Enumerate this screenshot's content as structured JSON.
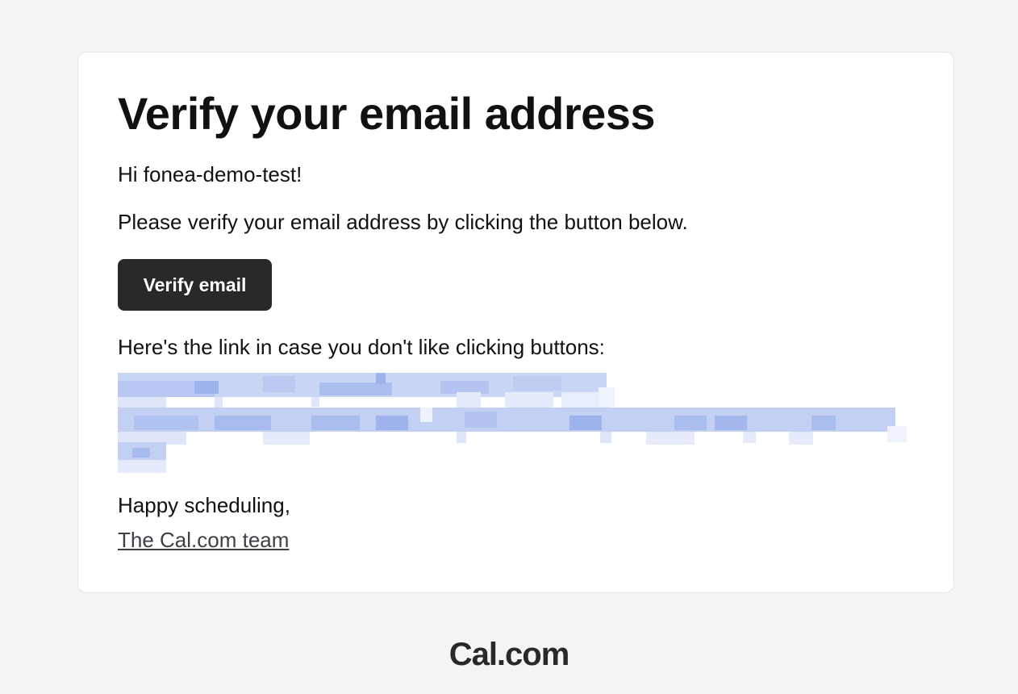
{
  "email": {
    "title": "Verify your email address",
    "greeting": "Hi fonea-demo-test!",
    "instructions": "Please verify your email address by clicking the button below.",
    "button_label": "Verify email",
    "link_intro": "Here's the link in case you don't like clicking buttons:",
    "signoff": "Happy scheduling,",
    "team_link_label": "The Cal.com team"
  },
  "footer": {
    "logo_text": "Cal.com"
  },
  "colors": {
    "page_background": "#f3f4f6",
    "card_background": "#ffffff",
    "button_background": "#292929",
    "redaction_tint": "#a9bdf0"
  }
}
